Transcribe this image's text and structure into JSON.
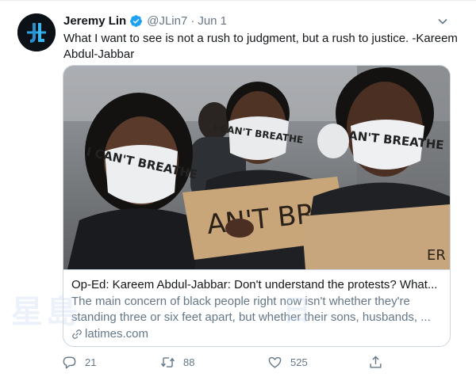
{
  "tweet": {
    "author_name": "Jeremy Lin",
    "author_handle": "@JLin7",
    "separator": "·",
    "date": "Jun 1",
    "text": "What I want to see is not a rush to judgment, but a rush to justice. -Kareem Abdul-Jabbar"
  },
  "card": {
    "title": "Op-Ed: Kareem Abdul-Jabbar: Don't understand the protests? What...",
    "description": "The main concern of black people right now isn't whether they're standing three or six feet apart, but whether their sons, husbands, ...",
    "domain": "latimes.com",
    "image_signs": {
      "mask_left": "I CAN'T BREATHE",
      "mask_center": "I CAN'T BREATHE",
      "mask_right": "I CAN'T BREATHE",
      "sign": "AN'T BR",
      "sign_right": "ER"
    }
  },
  "actions": {
    "reply_count": "21",
    "retweet_count": "88",
    "like_count": "525"
  },
  "watermark": {
    "left": "星島",
    "right": "日"
  },
  "colors": {
    "verified": "#1da1f2",
    "secondary_text": "#657786",
    "border": "#ccd6dd"
  },
  "icons": [
    "verified-badge-icon",
    "chevron-down-icon",
    "link-icon",
    "reply-icon",
    "retweet-icon",
    "like-icon",
    "share-icon"
  ]
}
